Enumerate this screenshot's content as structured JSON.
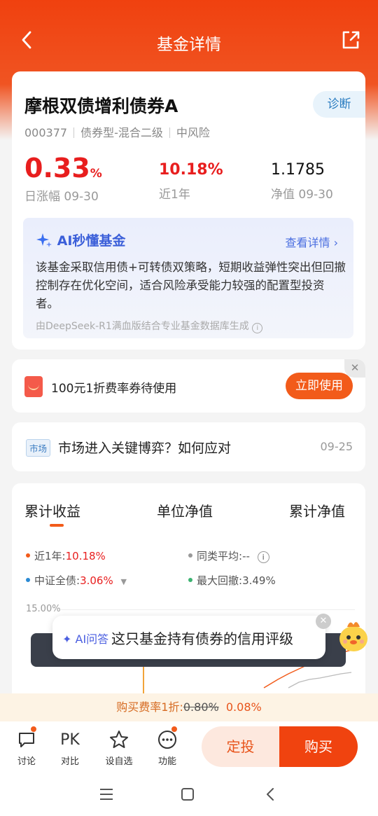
{
  "header": {
    "title": "基金详情"
  },
  "fund": {
    "name": "摩根双债增利债券A",
    "diagnose_label": "诊断",
    "code": "000377",
    "type": "债券型-混合二级",
    "risk": "中风险",
    "daily_change": "0.33",
    "daily_change_unit": "%",
    "daily_change_label": "日涨幅 09-30",
    "year_return": "10.18%",
    "year_return_label": "近1年",
    "nav": "1.1785",
    "nav_label": "净值 09-30"
  },
  "ai_summary": {
    "title": "AI秒懂基金",
    "more_label": "查看详情",
    "text": "该基金采取信用债+可转债双策略，短期收益弹性突出但回撤控制存在优化空间，适合风险承受能力较强的配置型投资者。",
    "source": "由DeepSeek-R1满血版结合专业基金数据库生成"
  },
  "coupon": {
    "text": "100元1折费率券待使用",
    "button": "立即使用"
  },
  "news": {
    "tag": "市场",
    "title": "市场进入关键博弈？如何应对",
    "date": "09-25"
  },
  "chart": {
    "tabs": [
      "累计收益",
      "单位净值",
      "累计净值"
    ],
    "legend": {
      "fund_label": "近1年:",
      "fund_value": "10.18%",
      "peer_label": "同类平均:",
      "peer_value": "--",
      "index_label": "中证全债:",
      "index_value": "3.06%",
      "drawdown_label": "最大回撤:",
      "drawdown_value": "3.49%"
    },
    "ymax_label": "15.00%",
    "colors": {
      "fund": "#f25b1a",
      "peer": "#999999",
      "index": "#2a8ad4",
      "drawdown": "#3cb371"
    }
  },
  "ai_bubble": {
    "tag": "AI问答",
    "text": "这只基金持有债券的信用评级"
  },
  "fee": {
    "label": "购买费率1折:",
    "old": "0.80%",
    "new": "0.08%"
  },
  "bottom_bar": {
    "items": [
      "讨论",
      "对比",
      "设自选",
      "功能"
    ],
    "pk_text": "PK",
    "auto_invest": "定投",
    "buy": "购买"
  }
}
